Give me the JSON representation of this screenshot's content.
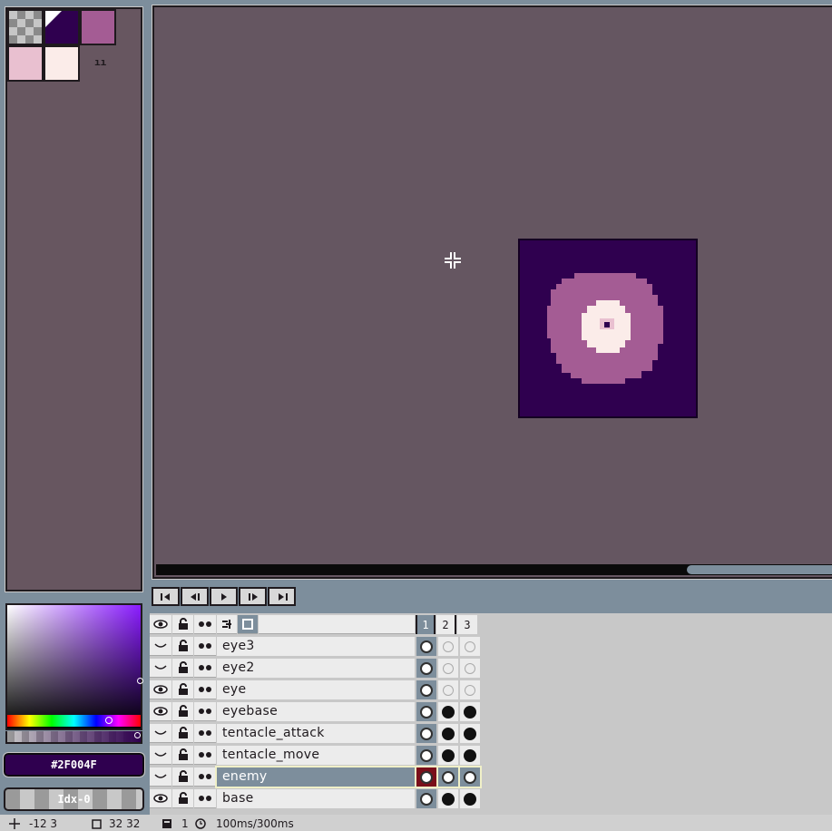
{
  "palette": {
    "colors": [
      "#2f004f",
      "#a45c94",
      "#e9c0d0",
      "#fbece9"
    ],
    "transparent_label": "transparent",
    "options_label": "ıı"
  },
  "color_picker": {
    "hex_value": "#2F004F",
    "frame_tag_label": "Idx-0"
  },
  "canvas": {
    "sprite_background": "#2f004f",
    "ring_color": "#a45c94",
    "pupil_color": "#fbece9",
    "center_color": "#2f004f"
  },
  "playback": {
    "buttons": [
      "first-frame",
      "previous-frame",
      "play",
      "next-frame",
      "last-frame"
    ]
  },
  "timeline": {
    "header_icons": [
      "eye-icon",
      "lock-icon",
      "continuous-icon",
      "link-icon",
      "square-icon"
    ],
    "frame_numbers": [
      "1",
      "2",
      "3"
    ],
    "layers": [
      {
        "name": "eye3",
        "visible": false,
        "frames": [
          "full",
          "empty",
          "empty"
        ]
      },
      {
        "name": "eye2",
        "visible": false,
        "frames": [
          "full",
          "empty",
          "empty"
        ]
      },
      {
        "name": "eye",
        "visible": true,
        "frames": [
          "full",
          "empty",
          "empty"
        ]
      },
      {
        "name": "eyebase",
        "visible": true,
        "frames": [
          "full",
          "black",
          "black"
        ]
      },
      {
        "name": "tentacle_attack",
        "visible": false,
        "frames": [
          "full",
          "black",
          "black"
        ]
      },
      {
        "name": "tentacle_move",
        "visible": false,
        "frames": [
          "full",
          "black",
          "black"
        ]
      },
      {
        "name": "enemy",
        "visible": false,
        "selected": true,
        "frames": [
          "full",
          "full",
          "full"
        ]
      },
      {
        "name": "base",
        "visible": true,
        "frames": [
          "full",
          "black",
          "black"
        ]
      }
    ]
  },
  "status_bar": {
    "cursor_position": "-12 3",
    "sprite_size": "32 32",
    "frame": "1",
    "duration": "100ms/300ms"
  }
}
